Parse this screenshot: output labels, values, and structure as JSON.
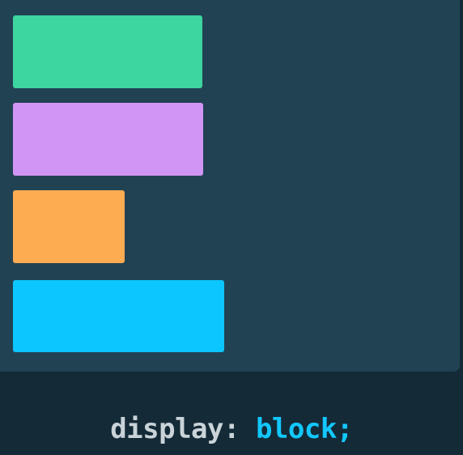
{
  "colors": {
    "page_background": "#142a37",
    "panel_background": "#214253",
    "property_text": "#c9d3d8",
    "value_text": "#12c8ff"
  },
  "boxes": [
    {
      "color": "#3dd5a0"
    },
    {
      "color": "#d195f5"
    },
    {
      "color": "#fdac52"
    },
    {
      "color": "#0bc6ff"
    }
  ],
  "code": {
    "property": "display:",
    "value": "block",
    "terminator": ";"
  }
}
